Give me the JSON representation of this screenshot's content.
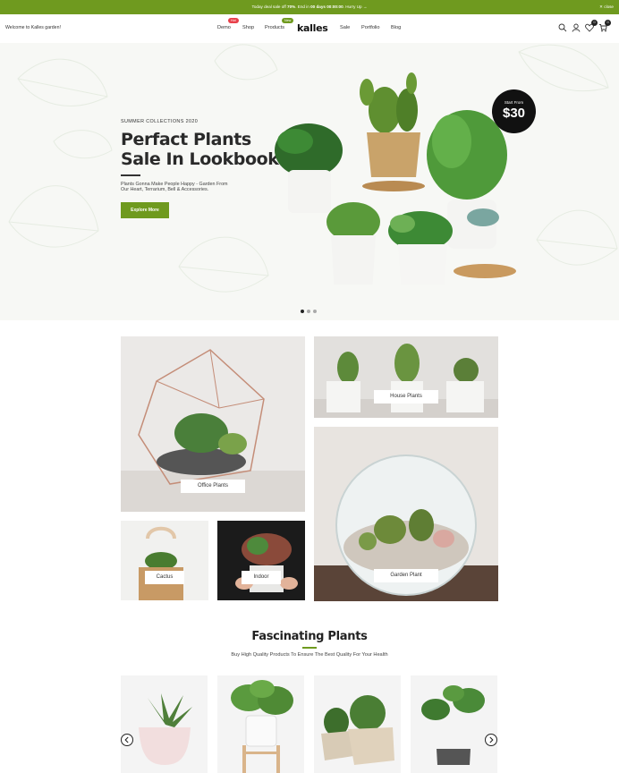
{
  "topbar": {
    "promo_prefix": "Today deal sale off ",
    "promo_percent": "70%",
    "promo_mid": ". End in ",
    "promo_time": "00 days 00:00:00",
    "promo_suffix": ". Hurry Up →",
    "close_label": "✕ close"
  },
  "header": {
    "welcome": "Welcome to Kalles garden!",
    "logo": "kalles",
    "nav": [
      {
        "label": "Demo",
        "badge": "Hot"
      },
      {
        "label": "Shop",
        "badge": ""
      },
      {
        "label": "Products",
        "badge": "New"
      },
      {
        "label": "Sale",
        "badge": ""
      },
      {
        "label": "Portfolio",
        "badge": ""
      },
      {
        "label": "Blog",
        "badge": ""
      }
    ],
    "icons": [
      "search-icon",
      "user-icon",
      "heart-icon",
      "cart-icon"
    ],
    "wishlist_count": "0",
    "cart_count": "0"
  },
  "hero": {
    "subtitle": "SUMMER COLLECTIONS 2020",
    "title_line1": "Perfact Plants",
    "title_line2": "Sale In Lookbook",
    "desc_line1": "Plants Gonna Make People Happy - Garden From",
    "desc_line2": "Our Heart, Terrarium, Bell & Accessories.",
    "button": "Explore More",
    "price_from": "Start From",
    "price": "$30",
    "slide_count": 3,
    "active_slide": 1
  },
  "categories": [
    {
      "label": "Office Plants"
    },
    {
      "label": "House Plants"
    },
    {
      "label": "Cactus"
    },
    {
      "label": "Indoor"
    },
    {
      "label": "Garden Plant"
    }
  ],
  "section": {
    "title": "Fascinating Plants",
    "subtitle": "Buy High Quality Products To Ensure The Best Quality For Your Health"
  },
  "colors": {
    "accent": "#6f9a1f",
    "hot_badge": "#e8404a",
    "dark": "#222222"
  }
}
